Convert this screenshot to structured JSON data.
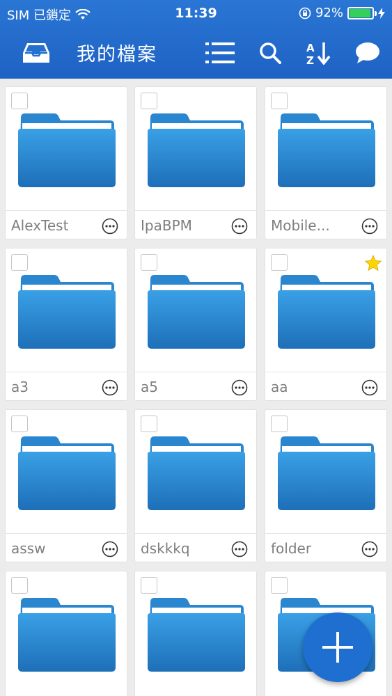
{
  "status_bar": {
    "carrier": "SIM 已鎖定",
    "time": "11:39",
    "battery": "92%"
  },
  "toolbar": {
    "title": "我的檔案",
    "icons": [
      "inbox-icon",
      "list-view-icon",
      "search-icon",
      "sort-az-icon",
      "chat-icon"
    ]
  },
  "files": [
    {
      "name": "AlexTest",
      "starred": false
    },
    {
      "name": "IpaBPM",
      "starred": false
    },
    {
      "name": "Mobile...",
      "starred": false
    },
    {
      "name": "a3",
      "starred": false
    },
    {
      "name": "a5",
      "starred": false
    },
    {
      "name": "aa",
      "starred": true
    },
    {
      "name": "assw",
      "starred": false
    },
    {
      "name": "dskkkq",
      "starred": false
    },
    {
      "name": "folder",
      "starred": false
    },
    {
      "name": "",
      "starred": false
    },
    {
      "name": "",
      "starred": false
    },
    {
      "name": "",
      "starred": false
    }
  ],
  "colors": {
    "header": "#2270cf",
    "folder": "#2a8ad4",
    "accent": "#1f6fd1",
    "star": "#ffd500"
  }
}
